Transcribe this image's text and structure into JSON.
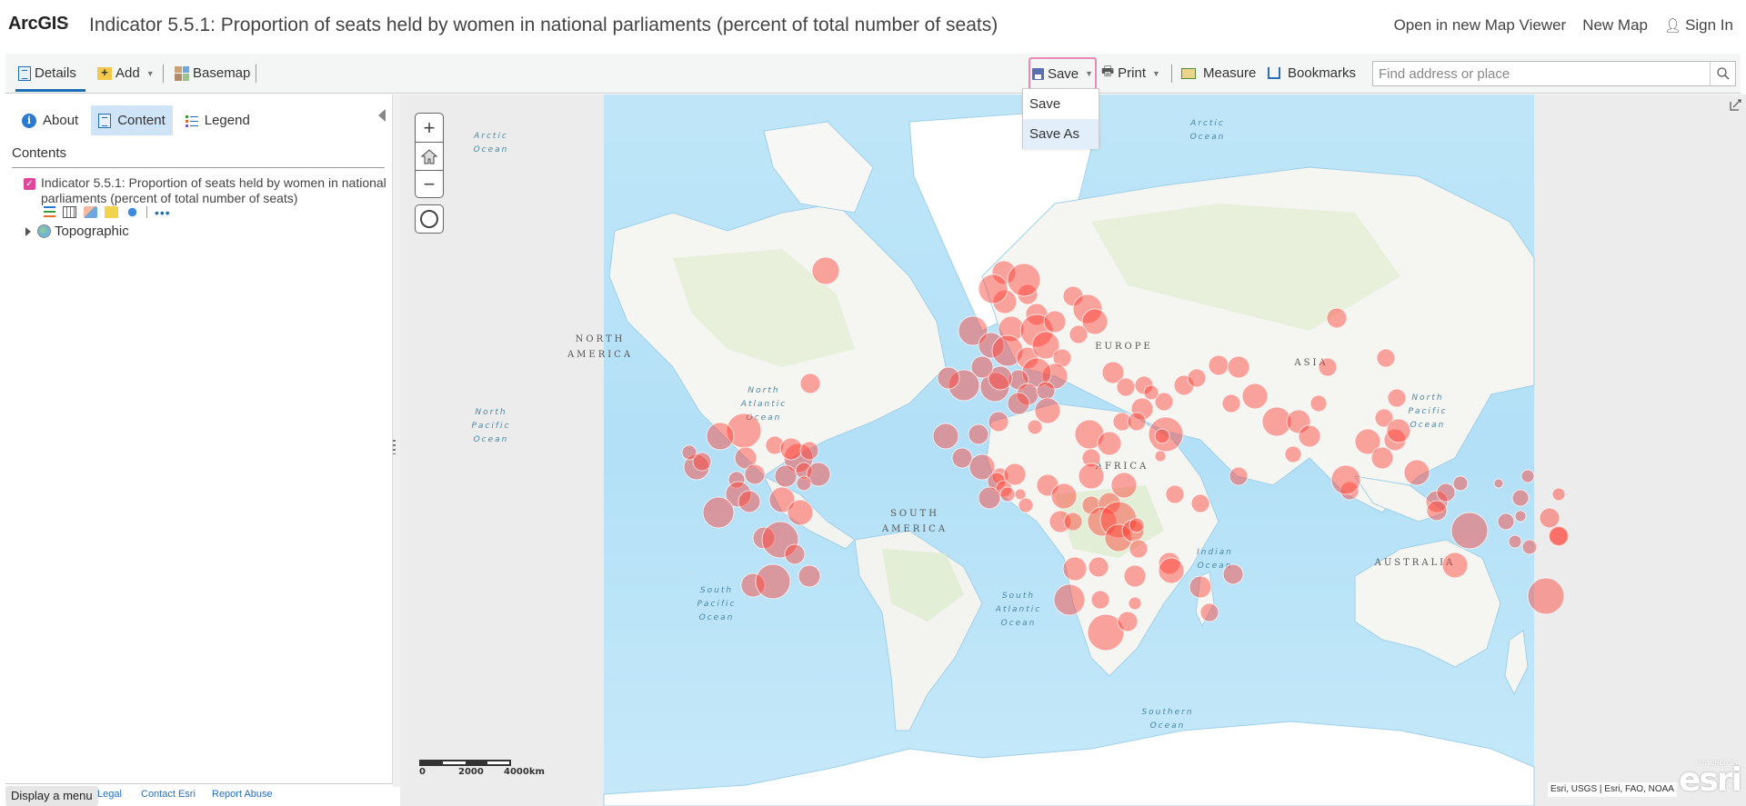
{
  "header": {
    "brand": "ArcGIS",
    "brand_caret": "▿",
    "title": "Indicator 5.5.1: Proportion of seats held by women in national parliaments (percent of total number of seats)",
    "links": {
      "open_new_viewer": "Open in new Map Viewer",
      "new_map": "New Map",
      "sign_in": "Sign In"
    }
  },
  "toolbar": {
    "details": "Details",
    "add": "Add",
    "basemap": "Basemap",
    "save": "Save",
    "print": "Print",
    "measure": "Measure",
    "bookmarks": "Bookmarks",
    "search_placeholder": "Find address or place",
    "search_value": ""
  },
  "save_menu": {
    "items": [
      "Save",
      "Save As"
    ],
    "highlighted": "Save As"
  },
  "panel": {
    "tabs": {
      "about": "About",
      "content": "Content",
      "legend": "Legend"
    },
    "active_tab": "Content",
    "contents_header": "Contents",
    "layers": [
      {
        "title": "Indicator 5.5.1: Proportion of seats held by women in national parliaments (percent of total number of seats)",
        "checked": true,
        "tools": [
          "show-legend-icon",
          "table-icon",
          "change-style-icon",
          "filter-icon",
          "perform-analysis-icon",
          "more-options-icon"
        ]
      }
    ],
    "basemap_layer": "Topographic"
  },
  "footer": {
    "display_menu": "Display a menu",
    "links": [
      "Legal",
      "Contact Esri",
      "Report Abuse"
    ]
  },
  "map": {
    "zoom_in": "+",
    "zoom_out": "−",
    "scale_labels": [
      "0",
      "2000",
      "4000km"
    ],
    "attribution": "Esri, USGS | Esri, FAO, NOAA",
    "esri_powered": "POWERED BY",
    "esri_word": "esri",
    "symbol_color": "#ff3b30",
    "ocean_labels": [
      [
        "Arctic",
        "Ocean"
      ],
      [
        "Arctic",
        "Ocean"
      ],
      [
        "North",
        "Pacific",
        "Ocean"
      ],
      [
        "North",
        "Atlantic",
        "Ocean"
      ],
      [
        "North",
        "Pacific",
        "Ocean"
      ],
      [
        "South",
        "Pacific",
        "Ocean"
      ],
      [
        "South",
        "Atlantic",
        "Ocean"
      ],
      [
        "Indian",
        "Ocean"
      ],
      [
        "Southern",
        "Ocean"
      ]
    ],
    "continent_labels": [
      [
        "NORTH",
        "AMERICA"
      ],
      [
        "SOUTH",
        "AMERICA"
      ],
      [
        "EUROPE"
      ],
      [
        "AFRICA"
      ],
      [
        "ASIA"
      ],
      [
        "AUSTRALIA"
      ]
    ]
  }
}
